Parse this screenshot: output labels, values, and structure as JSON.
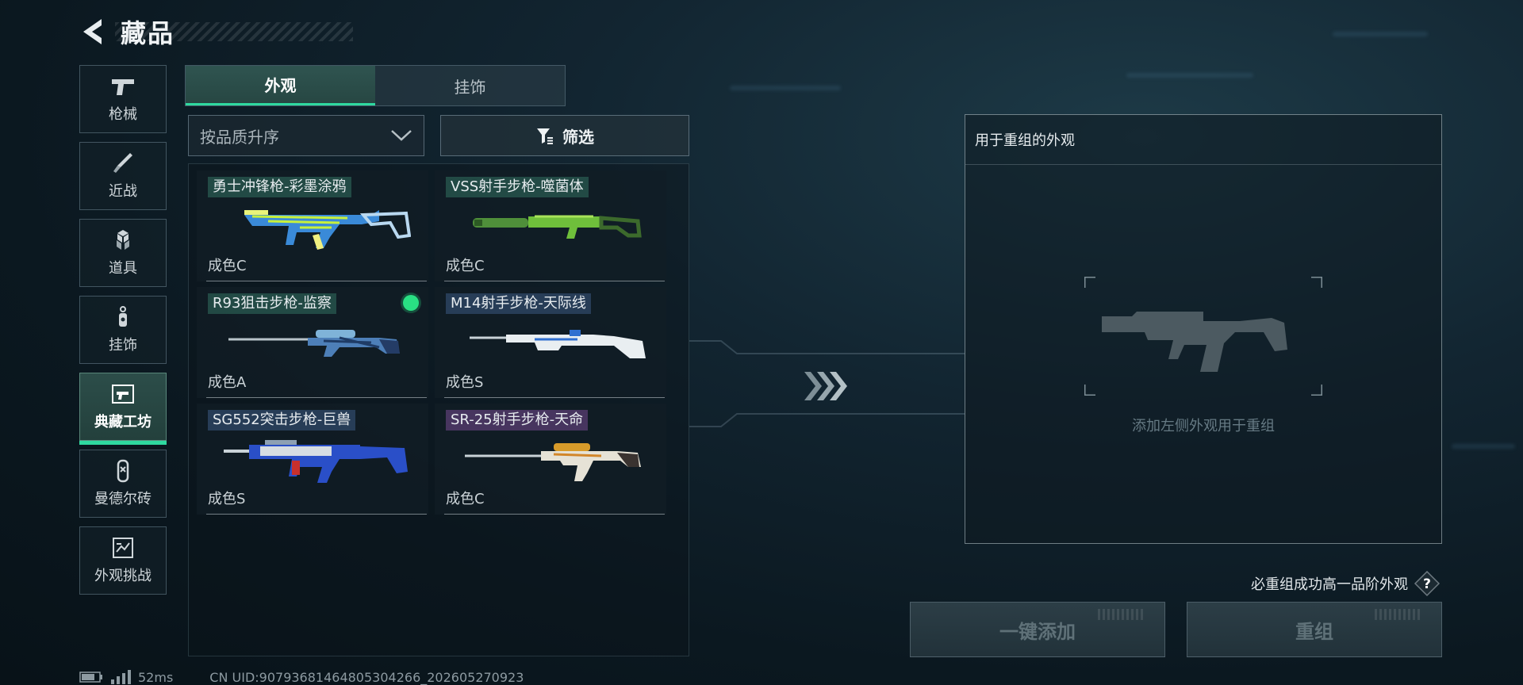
{
  "header": {
    "title": "藏品"
  },
  "sidebar": {
    "items": [
      {
        "label": "枪械",
        "icon": "pistol-icon"
      },
      {
        "label": "近战",
        "icon": "knife-icon"
      },
      {
        "label": "道具",
        "icon": "cubes-icon"
      },
      {
        "label": "挂饰",
        "icon": "charm-icon"
      },
      {
        "label": "典藏工坊",
        "icon": "workshop-icon",
        "active": true
      },
      {
        "label": "曼德尔砖",
        "icon": "brick-icon"
      },
      {
        "label": "外观挑战",
        "icon": "challenge-icon"
      }
    ]
  },
  "tabs": [
    {
      "label": "外观",
      "active": true
    },
    {
      "label": "挂饰",
      "active": false
    }
  ],
  "sort": {
    "label": "按品质升序"
  },
  "filter": {
    "label": "筛选"
  },
  "cards": [
    {
      "name": "勇士冲锋枪-彩墨涂鸦",
      "condition": "成色C",
      "tier": "green",
      "equipped": false
    },
    {
      "name": "VSS射手步枪-噬菌体",
      "condition": "成色C",
      "tier": "green",
      "equipped": false
    },
    {
      "name": "R93狙击步枪-监察",
      "condition": "成色A",
      "tier": "green",
      "equipped": true
    },
    {
      "name": "M14射手步枪-天际线",
      "condition": "成色S",
      "tier": "blue",
      "equipped": false
    },
    {
      "name": "SG552突击步枪-巨兽",
      "condition": "成色S",
      "tier": "blue",
      "equipped": false
    },
    {
      "name": "SR-25射手步枪-天命",
      "condition": "成色C",
      "tier": "purple",
      "equipped": false
    }
  ],
  "recombine": {
    "title": "用于重组的外观",
    "placeholder": "添加左侧外观用于重组",
    "hint": "必重组成功高一品阶外观",
    "add_all_label": "一键添加",
    "recombine_label": "重组"
  },
  "status": {
    "ping": "52ms",
    "uid": "CN UID:90793681464805304266_202605270923"
  },
  "colors": {
    "accent": "#2fd9a0",
    "equipped": "#29e083"
  }
}
